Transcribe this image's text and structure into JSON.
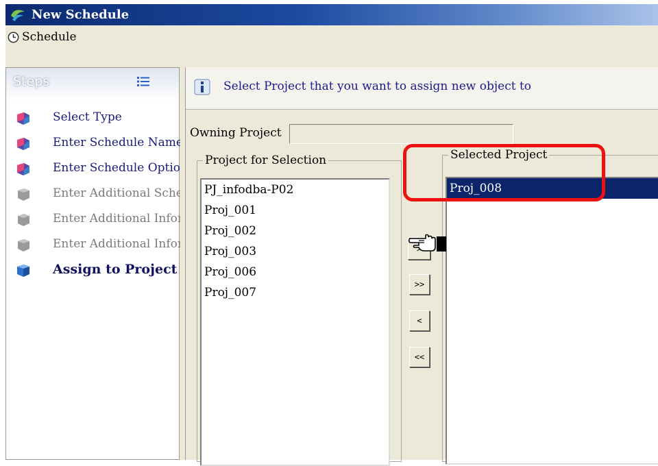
{
  "window": {
    "title": "New Schedule"
  },
  "menu": {
    "label": "Schedule"
  },
  "steps": {
    "header": "Steps",
    "items": [
      {
        "label": "Select Type",
        "state": "active"
      },
      {
        "label": "Enter Schedule Name a",
        "state": "active"
      },
      {
        "label": "Enter Schedule Option",
        "state": "active"
      },
      {
        "label": "Enter Additional Schec",
        "state": "disabled"
      },
      {
        "label": "Enter Additional Infor",
        "state": "disabled"
      },
      {
        "label": "Enter Additional Infor",
        "state": "disabled"
      },
      {
        "label": "Assign to Project",
        "state": "current"
      }
    ]
  },
  "info": {
    "text": "Select Project that you want to assign new object to"
  },
  "owning": {
    "label": "Owning Project",
    "value": ""
  },
  "left_group": {
    "legend": "Project for Selection",
    "items": [
      "PJ_infodba-P02",
      "Proj_001",
      "Proj_002",
      "Proj_003",
      "Proj_006",
      "Proj_007"
    ]
  },
  "right_group": {
    "legend": "Selected Project",
    "items": [
      "Proj_008"
    ]
  },
  "buttons": {
    "add": ">",
    "add_all": ">>",
    "remove": "<",
    "remove_all": "<<"
  },
  "colors": {
    "selection": "#0c246a",
    "highlight": "#ee1111",
    "title_bar": "#0b2a70"
  },
  "icons": {
    "app": "app-logo-icon",
    "menu": "clock-icon",
    "steps": "list-icon",
    "info": "info-icon",
    "cursor": "pointing-hand-cursor-icon"
  }
}
